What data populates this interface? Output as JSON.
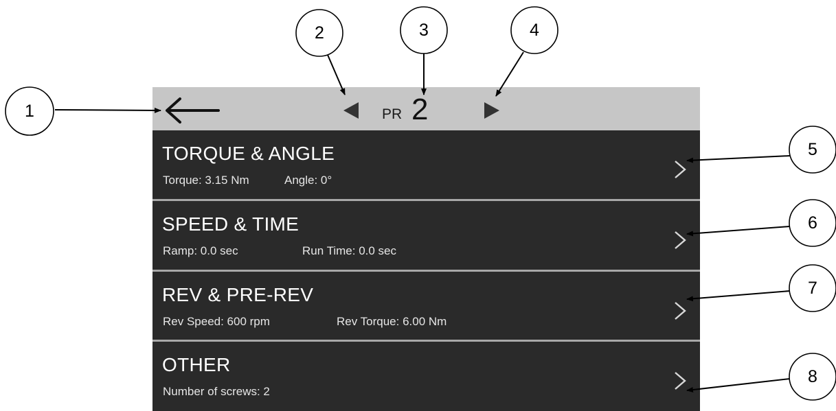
{
  "callouts": [
    "1",
    "2",
    "3",
    "4",
    "5",
    "6",
    "7",
    "8"
  ],
  "header": {
    "back_icon": "back-arrow-icon",
    "prev_icon": "previous-triangle-icon",
    "next_icon": "next-triangle-icon",
    "program_prefix": "PR",
    "program_number": "2"
  },
  "menu": {
    "items": [
      {
        "title": "TORQUE & ANGLE",
        "details": [
          "Torque: 3.15 Nm",
          "Angle: 0°"
        ],
        "icon": "chevron-right-icon"
      },
      {
        "title": "SPEED & TIME",
        "details": [
          "Ramp: 0.0 sec",
          "Run Time: 0.0 sec"
        ],
        "icon": "chevron-right-icon"
      },
      {
        "title": "REV & PRE-REV",
        "details": [
          "Rev Speed: 600 rpm",
          "Rev Torque: 6.00 Nm"
        ],
        "icon": "chevron-right-icon"
      },
      {
        "title": "OTHER",
        "details": [
          "Number of screws: 2"
        ],
        "icon": "chevron-right-icon"
      }
    ]
  },
  "colors": {
    "header_bg": "#c6c6c6",
    "row_bg": "#2a2a2a",
    "divider": "#a8a8a8",
    "text": "#ffffff",
    "icon_dark": "#333333"
  }
}
